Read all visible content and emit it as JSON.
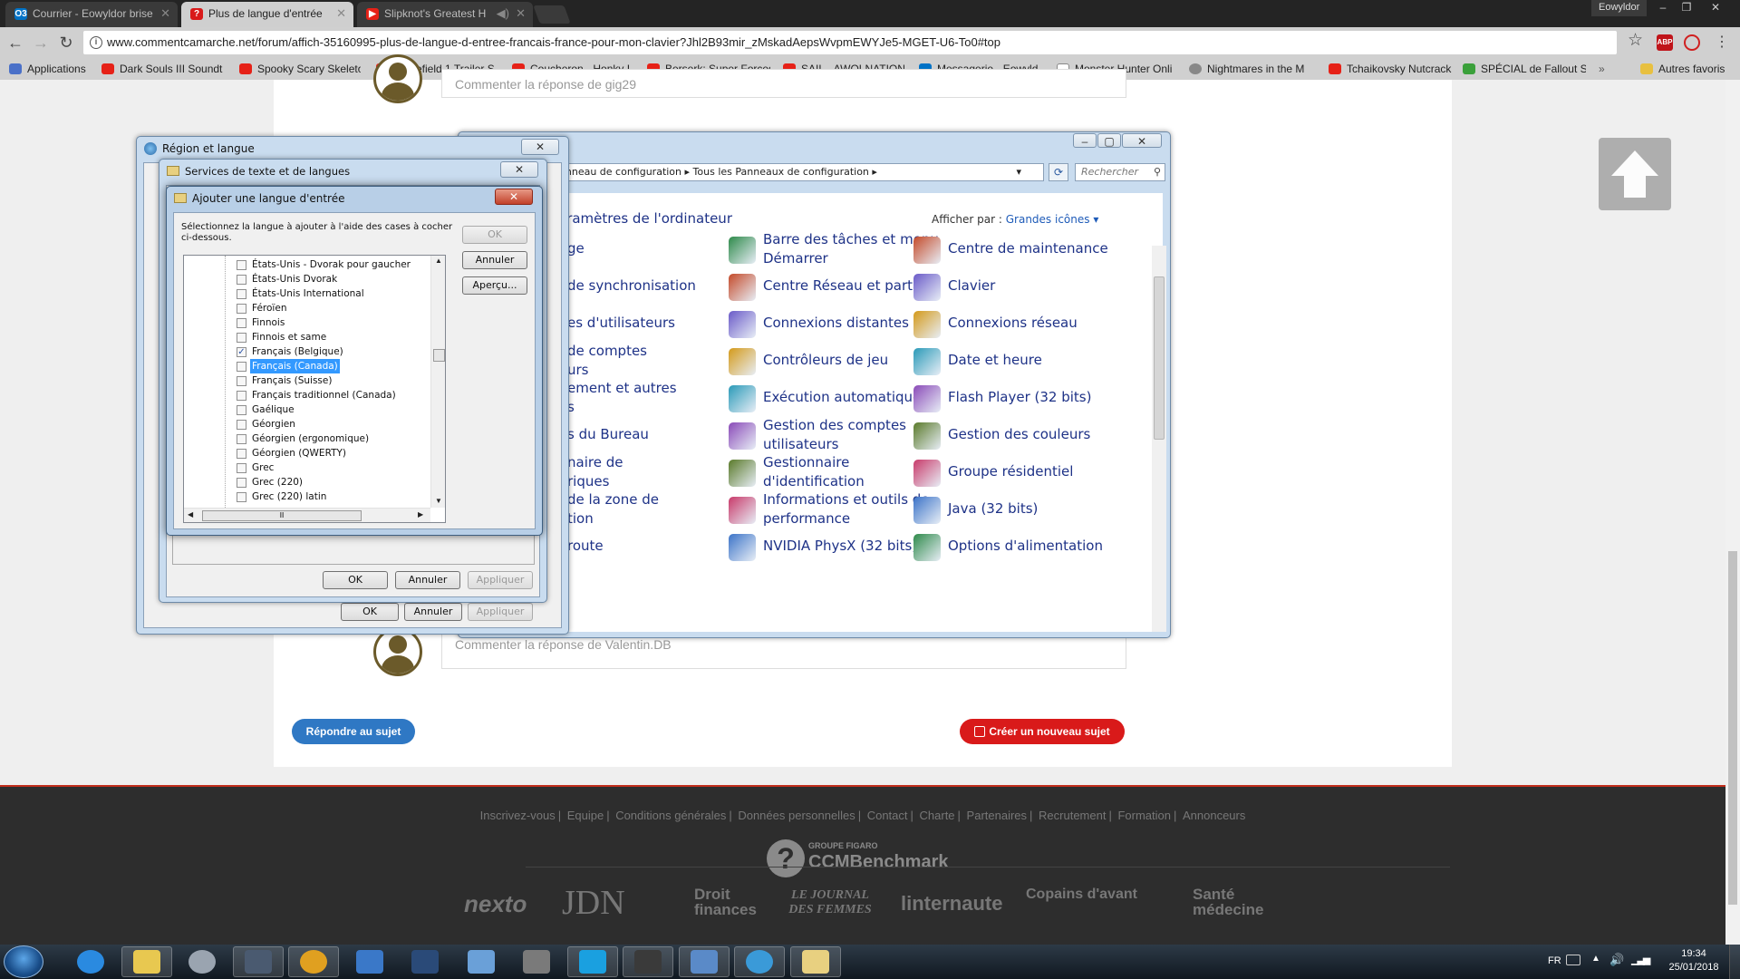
{
  "browser": {
    "tabs": [
      {
        "title": "Courrier - Eowyldor brise",
        "favicon": "O3",
        "favcolor": "#0072c6"
      },
      {
        "title": "Plus de langue d'entrée",
        "favicon": "?",
        "favcolor": "#d91a1a"
      },
      {
        "title": "Slipknot's Greatest H",
        "favicon": "▶",
        "favcolor": "#e62117"
      }
    ],
    "user": "Eowyldor",
    "url": "www.commentcamarche.net/forum/affich-35160995-plus-de-langue-d-entree-francais-france-pour-mon-clavier?Jhl2B93mir_zMskadAepsWvpmEWYJe5-MGET-U6-To0#top",
    "bookmarks": [
      {
        "label": "Applications",
        "color": "#4a70c8"
      },
      {
        "label": "Dark Souls III Soundt",
        "color": "#e62117"
      },
      {
        "label": "Spooky Scary Skeleto",
        "color": "#e62117"
      },
      {
        "label": "Battlefield 1 Trailer S",
        "color": "#e62117"
      },
      {
        "label": "Coucheron - Honky I",
        "color": "#e62117"
      },
      {
        "label": "Berserk: Super Forces",
        "color": "#e62117"
      },
      {
        "label": "SAIL - AWOLNATION",
        "color": "#e62117"
      },
      {
        "label": "Messagerie - Eowyld",
        "color": "#0072c6"
      },
      {
        "label": "Monster Hunter Onli",
        "color": "#ffffff"
      },
      {
        "label": "Nightmares in the M",
        "color": "#888888"
      },
      {
        "label": "Tchaikovsky Nutcrack",
        "color": "#e62117"
      },
      {
        "label": "SPÉCIAL de Fallout S",
        "color": "#3aa03a"
      },
      {
        "label": "Autres favoris",
        "color": "#e8c040"
      }
    ]
  },
  "page": {
    "comment_top": "Commenter la réponse de gig29",
    "comment_bottom": "Commenter la réponse de Valentin.DB",
    "reply_button": "Répondre au sujet",
    "new_topic_button": "Créer un nouveau sujet",
    "footer_links": [
      "Inscrivez-vous",
      "Equipe",
      "Conditions générales",
      "Données personnelles",
      "Contact",
      "Charte",
      "Partenaires",
      "Recrutement",
      "Formation",
      "Annonceurs"
    ],
    "footer_group": "GROUPE FIGARO",
    "footer_brand": "CCMBenchmark",
    "footer_partners": [
      "nexto",
      "JDN",
      "Droit finances",
      "LE JOURNAL DES FEMMES",
      "linternaute",
      "Copains d'avant",
      "Santé médecine"
    ]
  },
  "control_panel": {
    "breadcrumb": [
      "Panneau de configuration",
      "Tous les Panneaux de configuration"
    ],
    "search_placeholder": "Rechercher",
    "heading": "aramètres de l'ordinateur",
    "view_by_label": "Afficher par :",
    "view_by_value": "Grandes icônes",
    "left_items": [
      "ge",
      "de synchronisation",
      "es d'utilisateurs",
      "de comptes\nurs",
      "ement et autres\ns",
      "s du Bureau",
      "naire de\nriques",
      "de la zone de\ntion",
      "route"
    ],
    "mid_items": [
      "Barre des tâches et menu\nDémarrer",
      "Centre Réseau et partage",
      "Connexions distantes",
      "Contrôleurs de jeu",
      "Exécution automatique",
      "Gestion des comptes\nutilisateurs",
      "Gestionnaire\nd'identification",
      "Informations et outils de\nperformance",
      "NVIDIA PhysX (32 bits)"
    ],
    "right_items": [
      "Centre de maintenance",
      "Clavier",
      "Connexions réseau",
      "Date et heure",
      "Flash Player (32 bits)",
      "Gestion des couleurs",
      "Groupe résidentiel",
      "Java (32 bits)",
      "Options d'alimentation"
    ]
  },
  "region_dialog": {
    "title": "Région et langue",
    "ok": "OK",
    "cancel": "Annuler",
    "apply": "Appliquer"
  },
  "services_dialog": {
    "title": "Services de texte et de langues",
    "ok": "OK",
    "cancel": "Annuler",
    "apply": "Appliquer"
  },
  "add_language_dialog": {
    "title": "Ajouter une langue d'entrée",
    "instruction": "Sélectionnez la langue à ajouter à l'aide des cases à cocher ci-dessous.",
    "ok": "OK",
    "cancel": "Annuler",
    "preview": "Aperçu...",
    "languages": [
      {
        "label": "États-Unis - Dvorak pour gaucher",
        "checked": false,
        "selected": false
      },
      {
        "label": "États-Unis Dvorak",
        "checked": false,
        "selected": false
      },
      {
        "label": "États-Unis International",
        "checked": false,
        "selected": false
      },
      {
        "label": "Féroïen",
        "checked": false,
        "selected": false
      },
      {
        "label": "Finnois",
        "checked": false,
        "selected": false
      },
      {
        "label": "Finnois et same",
        "checked": false,
        "selected": false
      },
      {
        "label": "Français (Belgique)",
        "checked": true,
        "selected": false
      },
      {
        "label": "Français (Canada)",
        "checked": false,
        "selected": true
      },
      {
        "label": "Français (Suisse)",
        "checked": false,
        "selected": false
      },
      {
        "label": "Français traditionnel (Canada)",
        "checked": false,
        "selected": false
      },
      {
        "label": "Gaélique",
        "checked": false,
        "selected": false
      },
      {
        "label": "Géorgien",
        "checked": false,
        "selected": false
      },
      {
        "label": "Géorgien (ergonomique)",
        "checked": false,
        "selected": false
      },
      {
        "label": "Géorgien (QWERTY)",
        "checked": false,
        "selected": false
      },
      {
        "label": "Grec",
        "checked": false,
        "selected": false
      },
      {
        "label": "Grec (220)",
        "checked": false,
        "selected": false
      },
      {
        "label": "Grec (220) latin",
        "checked": false,
        "selected": false
      }
    ]
  },
  "taskbar": {
    "language": "FR",
    "time": "19:34",
    "date": "25/01/2018",
    "apps": [
      "internet-explorer",
      "file-explorer",
      "media-player",
      "steam",
      "chrome",
      "app-blue",
      "app-dark",
      "app-note",
      "app-tools",
      "skype",
      "app-games",
      "control-panel",
      "network",
      "keyboard-settings"
    ]
  }
}
